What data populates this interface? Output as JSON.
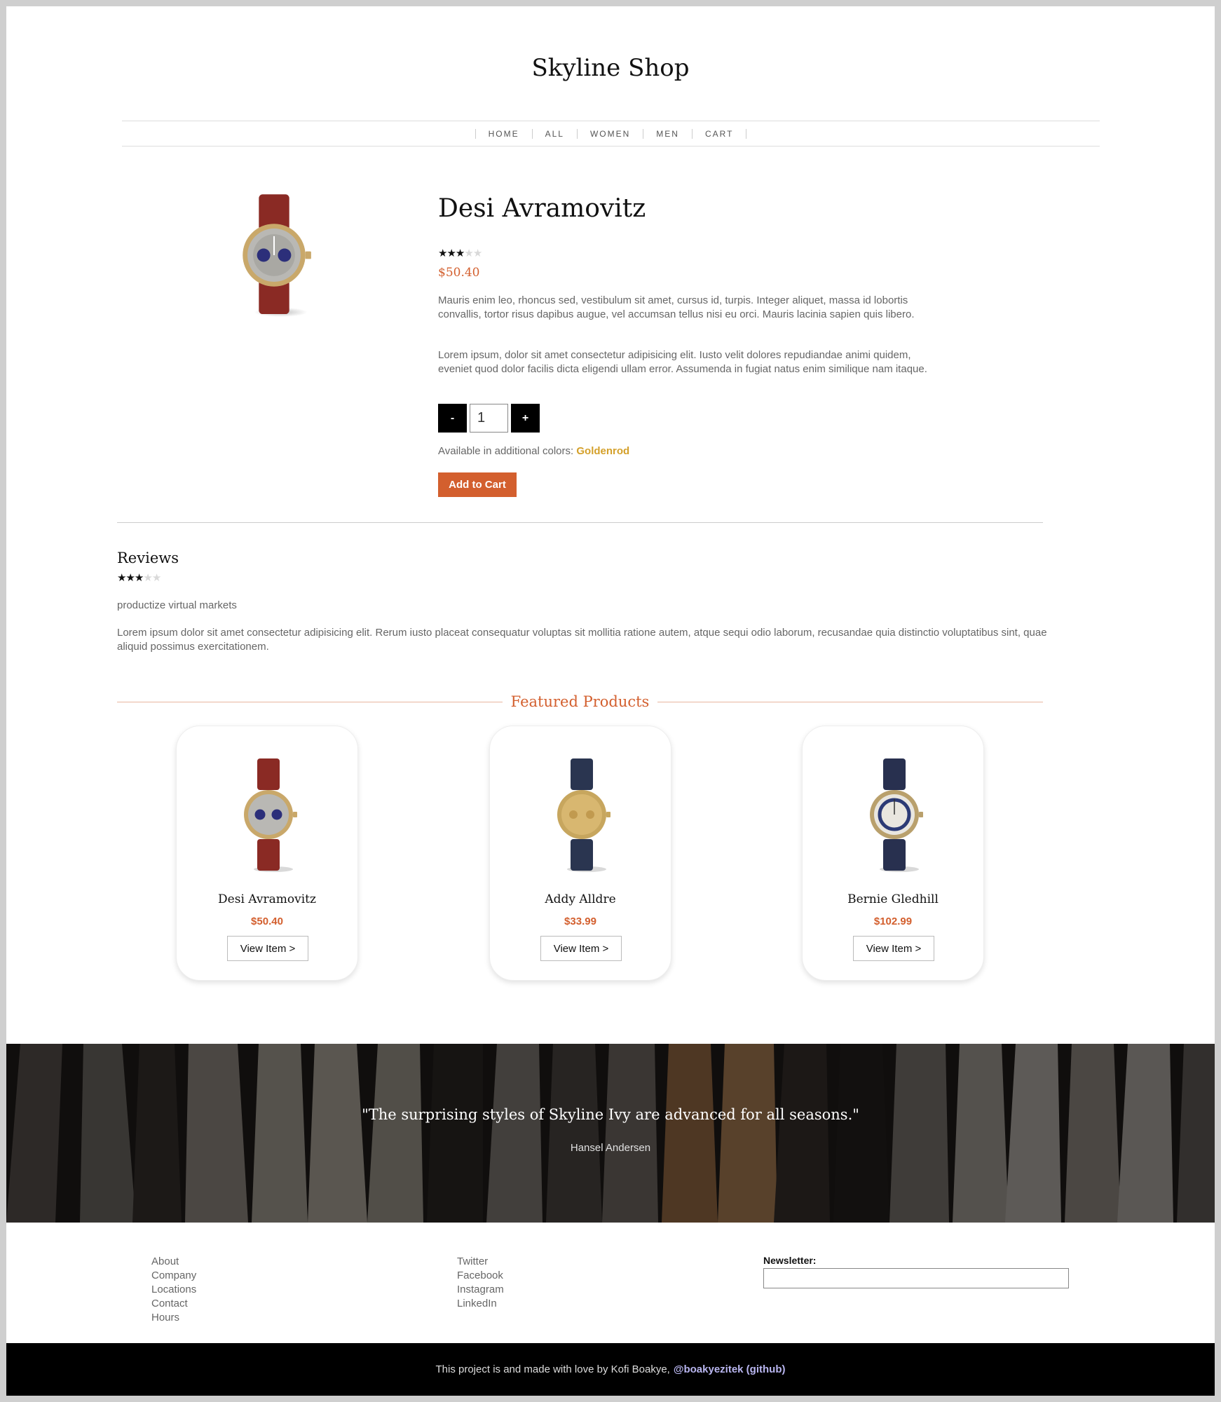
{
  "site": {
    "title": "Skyline Shop"
  },
  "nav": {
    "items": [
      "HOME",
      "ALL",
      "WOMEN",
      "MEN",
      "CART"
    ]
  },
  "product": {
    "name": "Desi Avramovitz",
    "rating": 3,
    "rating_max": 5,
    "price": "$50.40",
    "description": [
      "Mauris enim leo, rhoncus sed, vestibulum sit amet, cursus id, turpis. Integer aliquet, massa id lobortis convallis, tortor risus dapibus augue, vel accumsan tellus nisi eu orci. Mauris lacinia sapien quis libero.",
      "Lorem ipsum, dolor sit amet consectetur adipisicing elit. Iusto velit dolores repudiandae animi quidem, eveniet quod dolor facilis dicta eligendi ullam error. Assumenda in fugiat natus enim similique nam itaque."
    ],
    "quantity": {
      "minus_label": "-",
      "value": "1",
      "plus_label": "+"
    },
    "colors_label": "Available in additional colors:",
    "color_name": "Goldenrod",
    "add_to_cart_label": "Add to Cart",
    "image_icon": "watch-brown-strap-icon"
  },
  "reviews": {
    "title": "Reviews",
    "rating": 3,
    "rating_max": 5,
    "summary": "productize virtual markets",
    "body": "Lorem ipsum dolor sit amet consectetur adipisicing elit. Rerum iusto placeat consequatur voluptas sit mollitia ratione autem, atque sequi odio laborum, recusandae quia distinctio voluptatibus sint, quae aliquid possimus exercitationem."
  },
  "featured": {
    "heading": "Featured Products",
    "items": [
      {
        "name": "Desi Avramovitz",
        "price": "$50.40",
        "button": "View Item >",
        "image_icon": "watch-brown-strap-icon"
      },
      {
        "name": "Addy Alldre",
        "price": "$33.99",
        "button": "View Item >",
        "image_icon": "watch-gold-face-icon"
      },
      {
        "name": "Bernie Gledhill",
        "price": "$102.99",
        "button": "View Item >",
        "image_icon": "watch-blue-strap-icon"
      }
    ]
  },
  "banner": {
    "quote": "\"The surprising styles of Skyline Ivy are advanced for all seasons.\"",
    "author": "Hansel Andersen"
  },
  "footer": {
    "col1": [
      "About",
      "Company",
      "Locations",
      "Contact",
      "Hours"
    ],
    "col2": [
      "Twitter",
      "Facebook",
      "Instagram",
      "LinkedIn"
    ],
    "newsletter_label": "Newsletter:",
    "credit": "This project is and made with love by Kofi Boakye,",
    "github_link": "@boakyezitek (github)"
  },
  "colors": {
    "accent": "#d35f2e",
    "goldenrod": "#d4a02a",
    "link": "#b9b6f0"
  }
}
